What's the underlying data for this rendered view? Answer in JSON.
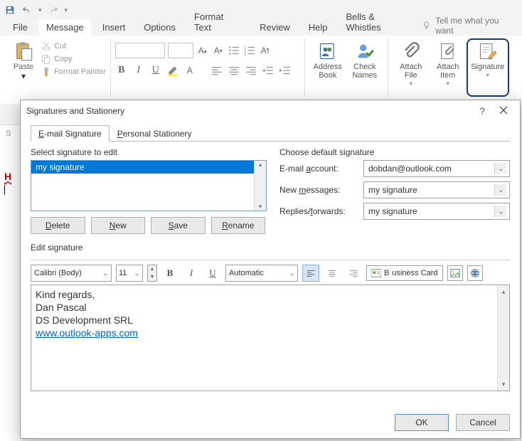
{
  "menu": {
    "file": "File",
    "message": "Message",
    "insert": "Insert",
    "options": "Options",
    "format_text": "Format Text",
    "review": "Review",
    "help": "Help",
    "bells": "Bells & Whistles",
    "tell_me": "Tell me what you want"
  },
  "ribbon": {
    "paste": "Paste",
    "cut": "Cut",
    "copy": "Copy",
    "fpainter": "Format Painter",
    "address_book": "Address\nBook",
    "check_names": "Check\nNames",
    "attach_file": "Attach\nFile",
    "attach_item": "Attach\nItem",
    "signature": "Signature"
  },
  "sliver": {
    "s": "S",
    "h": "H"
  },
  "dialog": {
    "title": "Signatures and Stationery",
    "tab_email": "E-mail Signature",
    "tab_stationery": "Personal Stationery",
    "tab_stationery_ul": "P",
    "select_label": "Select signature to edit",
    "select_ul": "c",
    "list_item": "my signature",
    "btn_delete": "Delete",
    "btn_delete_ul": "D",
    "btn_new": "New",
    "btn_new_ul": "N",
    "btn_save": "Save",
    "btn_save_ul": "S",
    "btn_rename": "Rename",
    "btn_rename_ul": "R",
    "choose_label": "Choose default signature",
    "email_account": "E-mail account:",
    "email_account_ul": "a",
    "email_value": "dobdan@outlook.com",
    "new_msgs": "New messages:",
    "new_msgs_ul": "m",
    "new_msgs_value": "my signature",
    "replies": "Replies/forwards:",
    "replies_ul": "f",
    "replies_value": "my signature",
    "edit_label": "Edit signature",
    "edit_ul": "T",
    "font": "Calibri (Body)",
    "size": "11",
    "color": "Automatic",
    "bizcard": "Business Card",
    "bizcard_ul": "B",
    "sig_line1": "Kind regards,",
    "sig_line2": "Dan Pascal",
    "sig_line3": "DS Development SRL",
    "sig_link": "www.outlook-apps.com",
    "ok": "OK",
    "cancel": "Cancel"
  }
}
